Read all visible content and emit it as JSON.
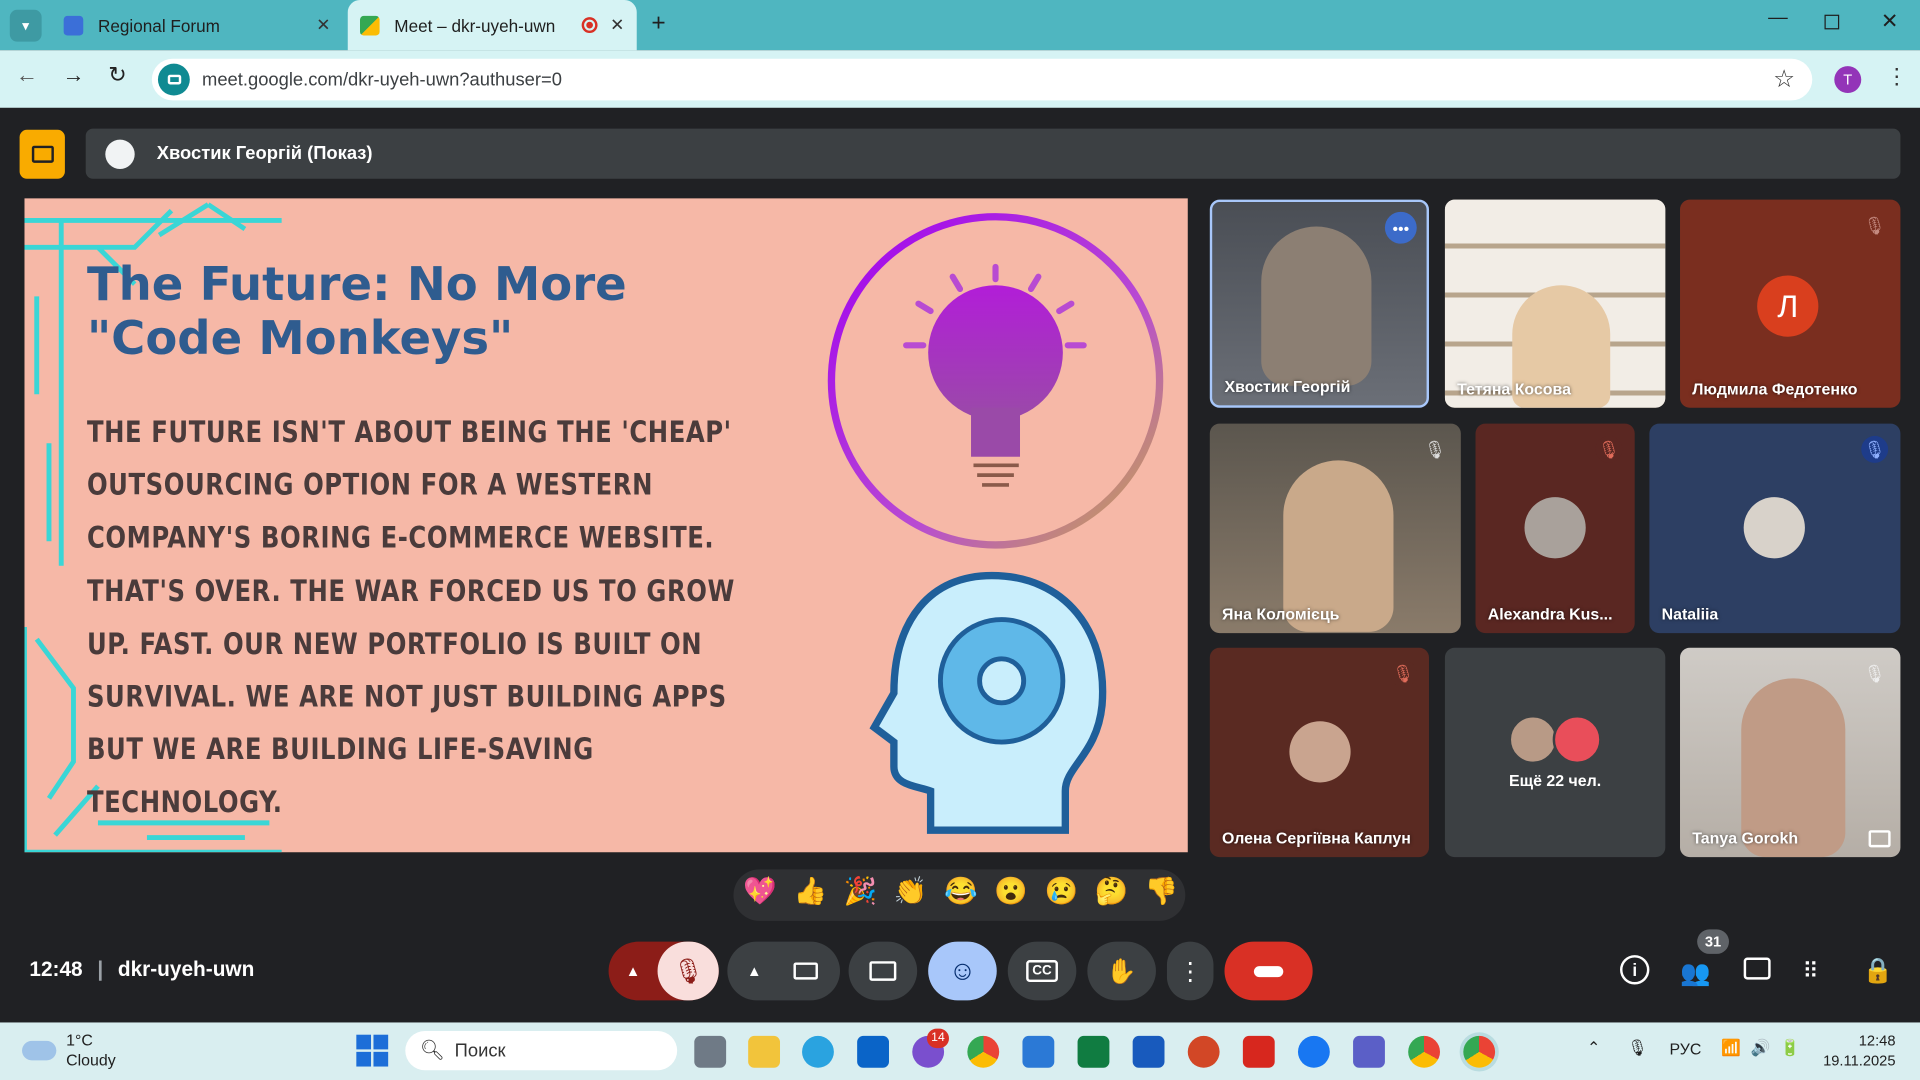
{
  "browser": {
    "tabs": [
      {
        "title": "Regional Forum",
        "active": false
      },
      {
        "title": "Meet – dkr-uyeh-uwn",
        "active": true
      }
    ],
    "url": "meet.google.com/dkr-uyeh-uwn?authuser=0",
    "profile_initial": "T",
    "accent_color": "#4fb6c0"
  },
  "meet": {
    "presenter_label": "Хвостик Георгій (Показ)",
    "meeting_time": "12:48",
    "meeting_code": "dkr-uyeh-uwn",
    "people_count": "31",
    "slide": {
      "title": "The Future: No More \"Code Monkeys\"",
      "body": "The future isn't about being the 'cheap' outsourcing option for a Western company's boring e-commerce website. That's over. The war forced us to grow up. Fast. Our new portfolio is built on survival. We are not just building apps but we are building life-saving technology."
    },
    "participants": [
      {
        "name": "Хвостик Георгій",
        "type": "video",
        "muted": false
      },
      {
        "name": "Тетяна Косова",
        "type": "video",
        "muted": false
      },
      {
        "name": "Людмила Федотенко",
        "type": "avatar",
        "initial": "Л",
        "muted": true
      },
      {
        "name": "Яна Коломієць",
        "type": "video",
        "muted": true
      },
      {
        "name": "Alexandra Kus...",
        "type": "avatar",
        "muted": true
      },
      {
        "name": "Nataliia",
        "type": "avatar",
        "muted": true
      },
      {
        "name": "Олена Сергіївна Каплун",
        "type": "avatar",
        "muted": true
      },
      {
        "name": "Ещё 22 чел.",
        "type": "overflow",
        "muted": false
      },
      {
        "name": "Tanya Gorokh",
        "type": "video",
        "muted": true
      }
    ],
    "reactions": [
      "💖",
      "👍",
      "🎉",
      "👏",
      "😂",
      "😮",
      "😢",
      "🤔",
      "👎"
    ]
  },
  "taskbar": {
    "weather_temp": "1°C",
    "weather_desc": "Cloudy",
    "search_placeholder": "Поиск",
    "viber_badge": "14",
    "language": "РУС",
    "clock_time": "12:48",
    "clock_date": "19.11.2025"
  }
}
